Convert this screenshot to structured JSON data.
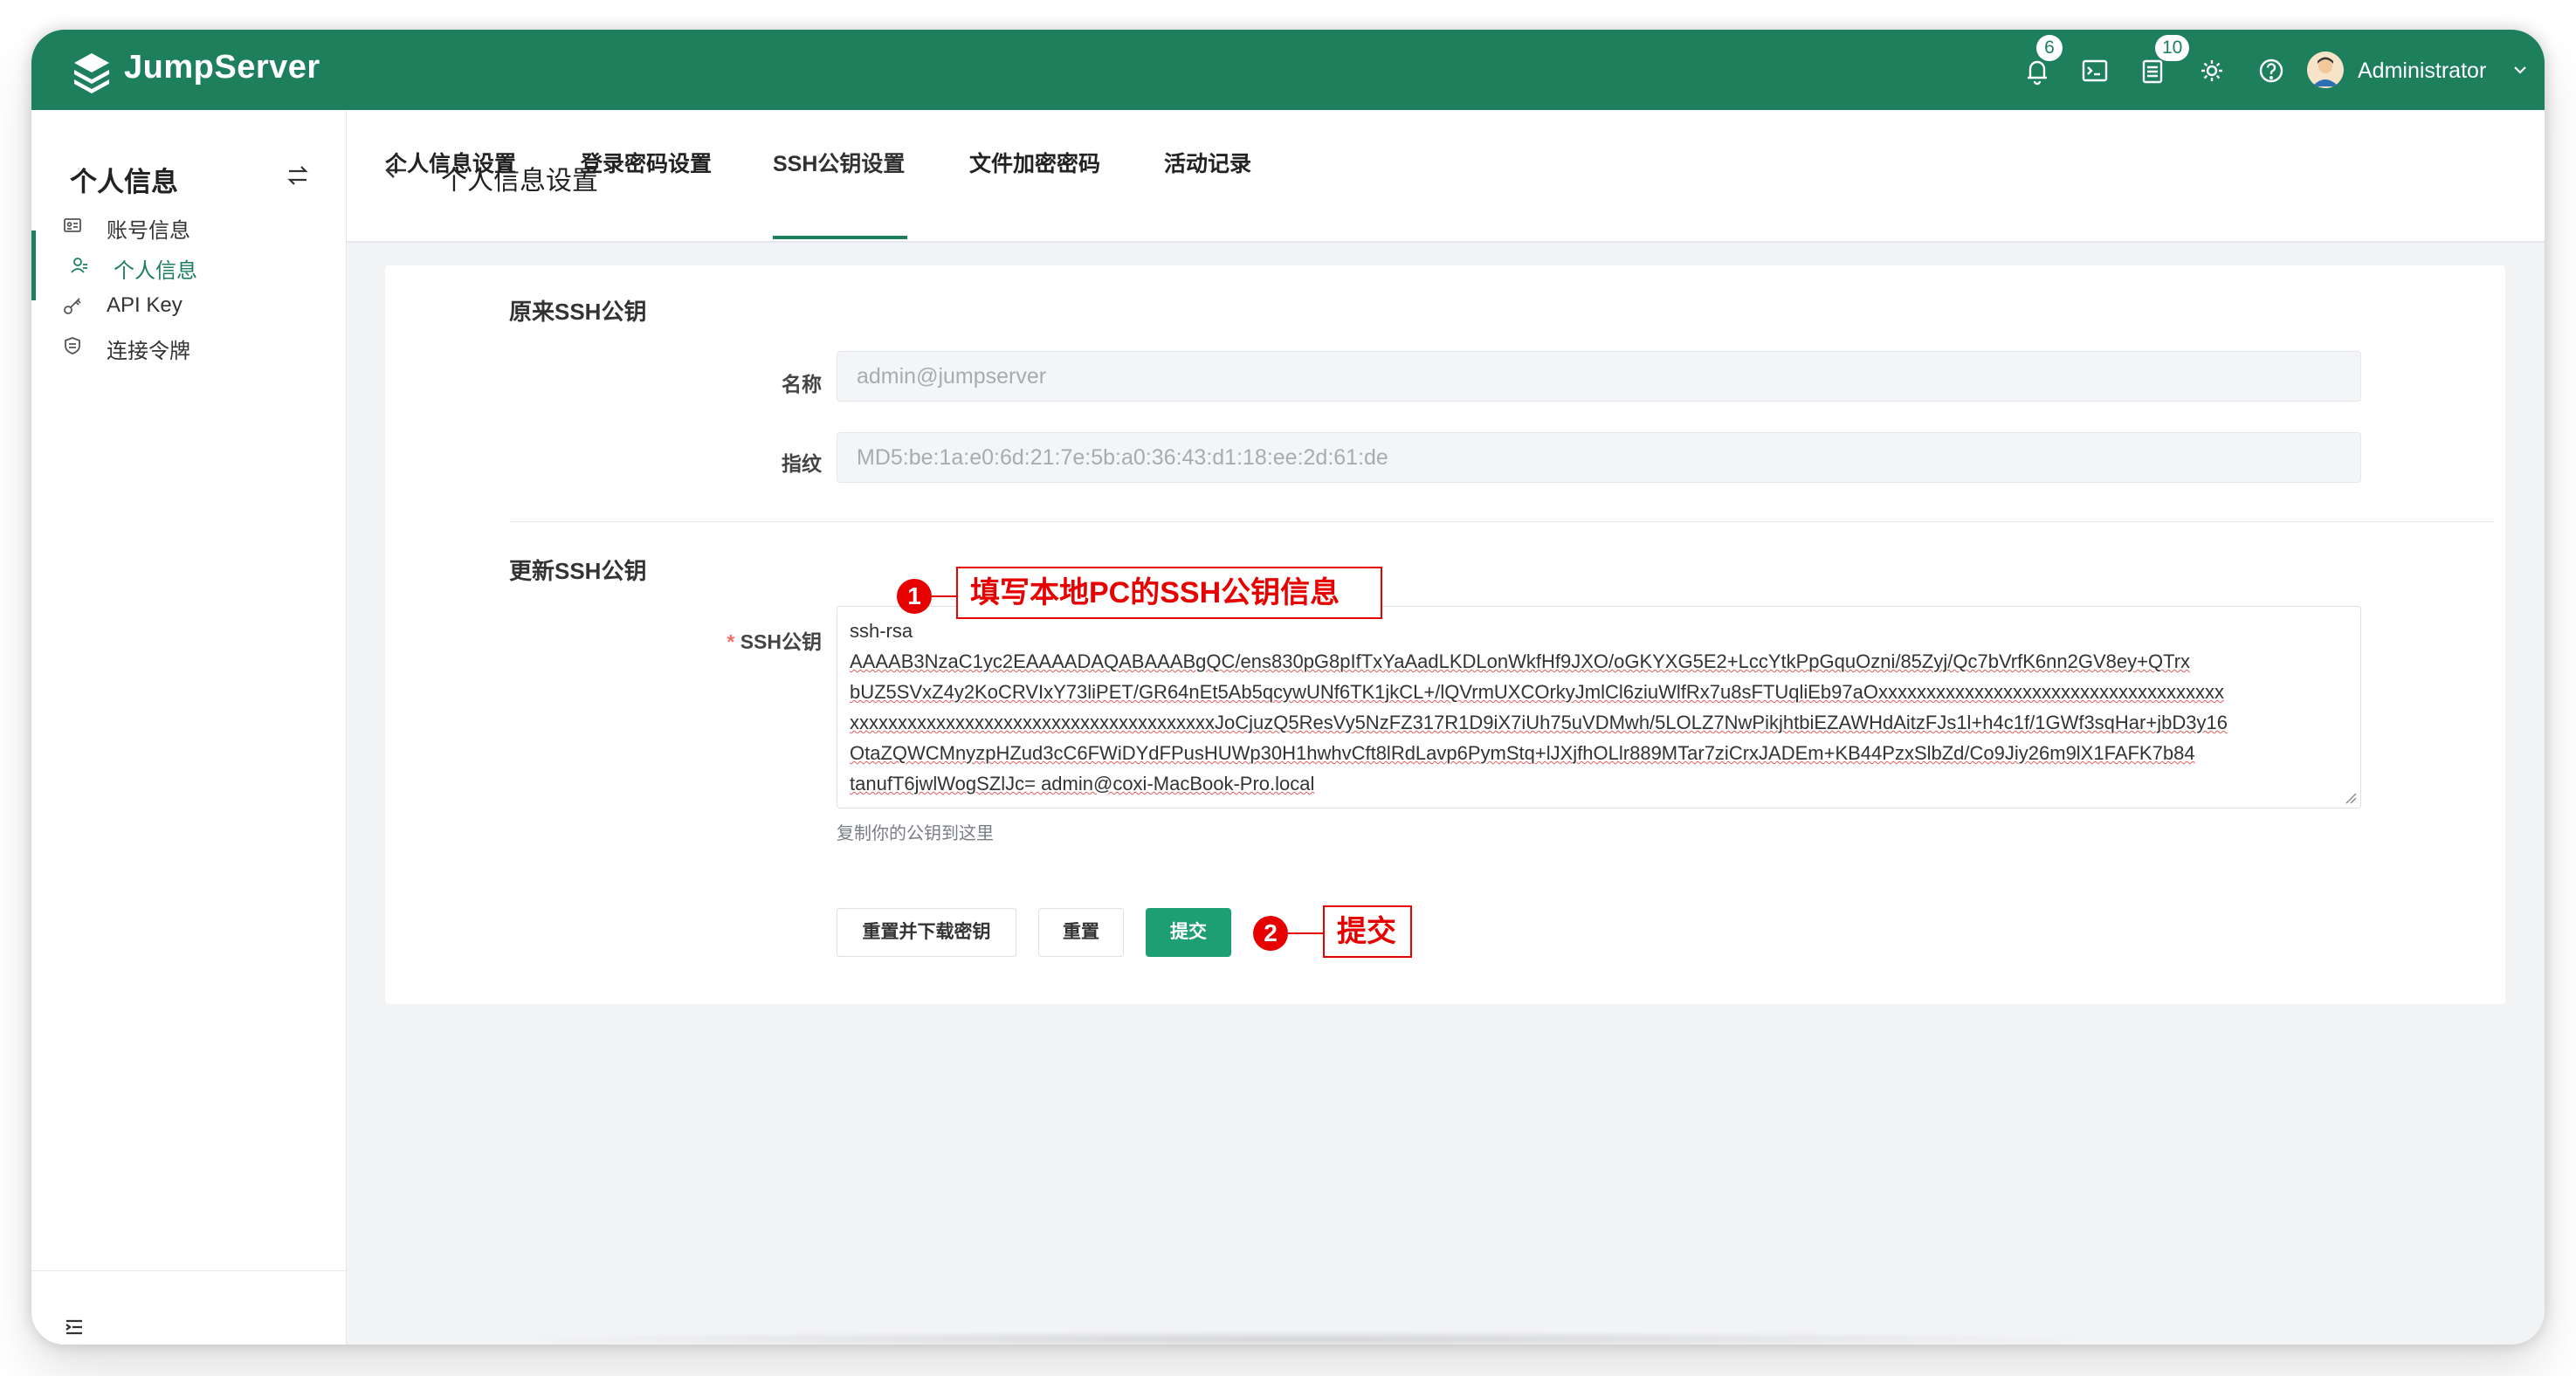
{
  "app": {
    "brand": "JumpServer",
    "colors": {
      "primary": "#1e7f5c",
      "button_primary": "#1e9f73",
      "annotation": "#e60000"
    }
  },
  "topbar": {
    "notifications_badge": "6",
    "tickets_badge": "10",
    "user_name": "Administrator"
  },
  "sidebar": {
    "title": "个人信息",
    "items": [
      {
        "label": "账号信息",
        "icon": "id-card-icon"
      },
      {
        "label": "个人信息",
        "icon": "user-icon",
        "active": true
      },
      {
        "label": "API Key",
        "icon": "key-icon"
      },
      {
        "label": "连接令牌",
        "icon": "shield-icon"
      }
    ]
  },
  "header": {
    "title": "个人信息设置",
    "tabs": [
      {
        "label": "个人信息设置"
      },
      {
        "label": "登录密码设置"
      },
      {
        "label": "SSH公钥设置",
        "active": true
      },
      {
        "label": "文件加密密码"
      },
      {
        "label": "活动记录"
      }
    ]
  },
  "form": {
    "old_section_title": "原来SSH公钥",
    "name_label": "名称",
    "name_value": "admin@jumpserver",
    "fingerprint_label": "指纹",
    "fingerprint_value": "MD5:be:1a:e0:6d:21:7e:5b:a0:36:43:d1:18:ee:2d:61:de",
    "update_section_title": "更新SSH公钥",
    "ssh_key_required_mark": "*",
    "ssh_key_label": "SSH公钥",
    "ssh_key_lines": [
      "ssh-rsa",
      "AAAAB3NzaC1yc2EAAAADAQABAAABgQC/ens830pG8pIfTxYaAadLKDLonWkfHf9JXO/oGKYXG5E2+LccYtkPpGquOzni/85Zyj/Qc7bVrfK6nn2GV8ey+QTrx",
      "bUZ5SVxZ4y2KoCRVIxY73liPET/GR64nEt5Ab5qcywUNf6TK1jkCL+/lQVrmUXCOrkyJmlCl6ziuWlfRx7u8sFTUqliEb97aOxxxxxxxxxxxxxxxxxxxxxxxxxxxxxxxxxxxx",
      "xxxxxxxxxxxxxxxxxxxxxxxxxxxxxxxxxxxxxxJoCjuzQ5ResVy5NzFZ317R1D9iX7iUh75uVDMwh/5LOLZ7NwPikjhtbiEZAWHdAitzFJs1l+h4c1f/1GWf3sqHar+jbD3y16",
      "OtaZQWCMnyzpHZud3cC6FWiDYdFPusHUWp30H1hwhvCft8lRdLavp6PymStq+lJXjfhOLlr889MTar7ziCrxJADEm+KB44PzxSlbZd/Co9Jiy26m9lX1FAFK7b84",
      "tanufT6jwlWogSZlJc= admin@coxi-MacBook-Pro.local"
    ],
    "hint": "复制你的公钥到这里",
    "buttons": {
      "reset_download": "重置并下载密钥",
      "reset": "重置",
      "submit": "提交"
    }
  },
  "annotations": [
    {
      "number": "1",
      "text": "填写本地PC的SSH公钥信息"
    },
    {
      "number": "2",
      "text": "提交"
    }
  ]
}
